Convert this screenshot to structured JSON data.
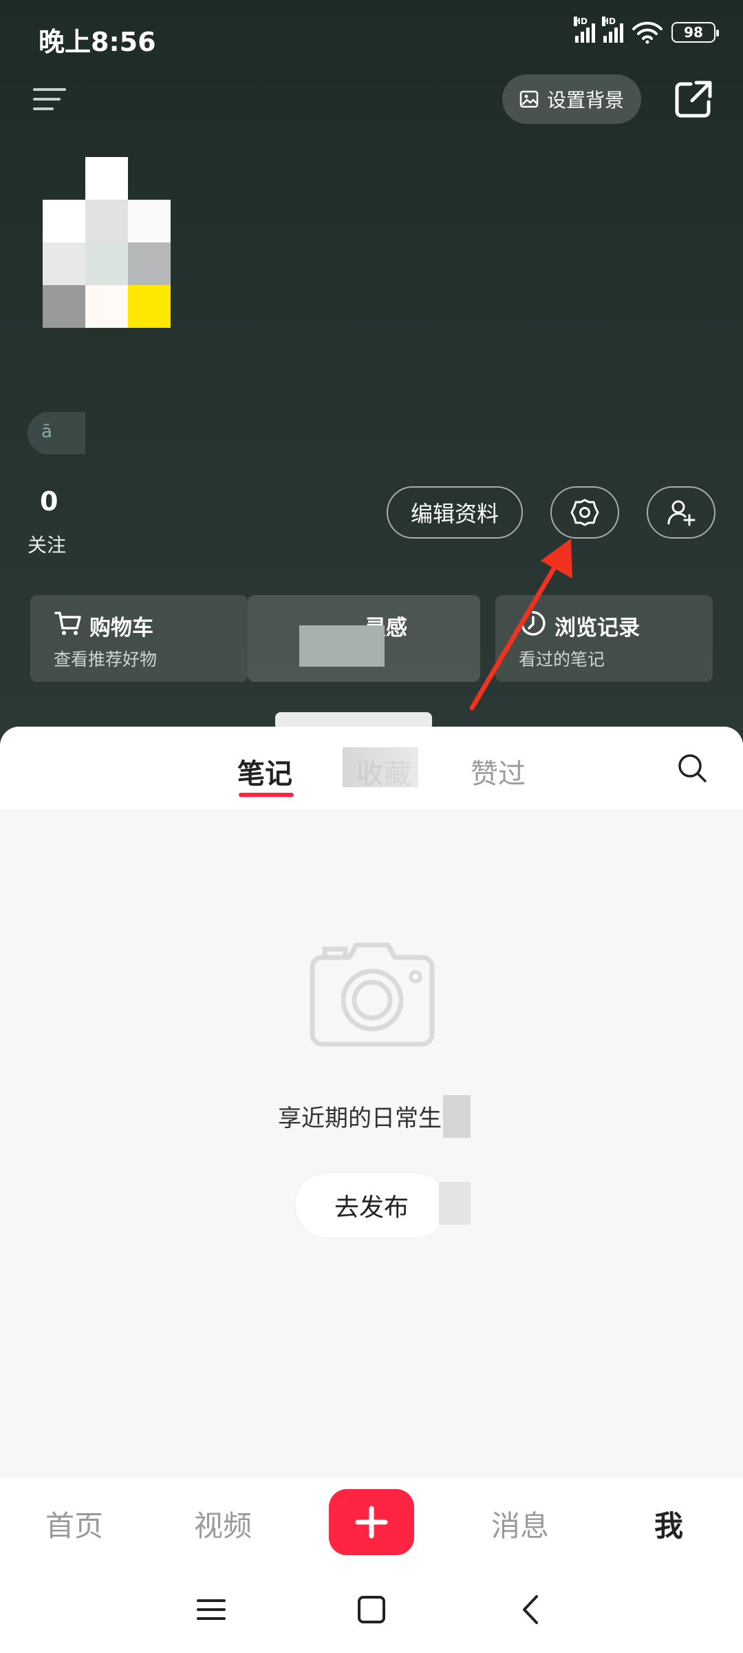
{
  "status_bar": {
    "time": "晚上8:56",
    "signal_label_1": "HD",
    "signal_label_2": "HD",
    "battery": "98"
  },
  "header": {
    "set_background_label": "设置背景",
    "pill_text": "ā",
    "stat_value": "0",
    "stat_label": "关注",
    "edit_profile_label": "编辑资料"
  },
  "cards": [
    {
      "title": "购物车",
      "subtitle": "查看推荐好物",
      "icon": "cart-icon"
    },
    {
      "title": "灵感",
      "subtitle": "",
      "icon": "inspiration-icon"
    },
    {
      "title": "浏览记录",
      "subtitle": "看过的笔记",
      "icon": "history-icon"
    }
  ],
  "tabs": [
    "笔记",
    "收藏",
    "赞过"
  ],
  "active_tab": "笔记",
  "empty_state": {
    "text": "享近期的日常生活",
    "button": "去发布"
  },
  "bottom_nav": {
    "items": [
      "首页",
      "视频",
      "消息",
      "我"
    ],
    "active": "我"
  },
  "colors": {
    "accent": "#ff2442",
    "header_bg": "#24302d",
    "annotation_arrow": "#f0321e"
  }
}
